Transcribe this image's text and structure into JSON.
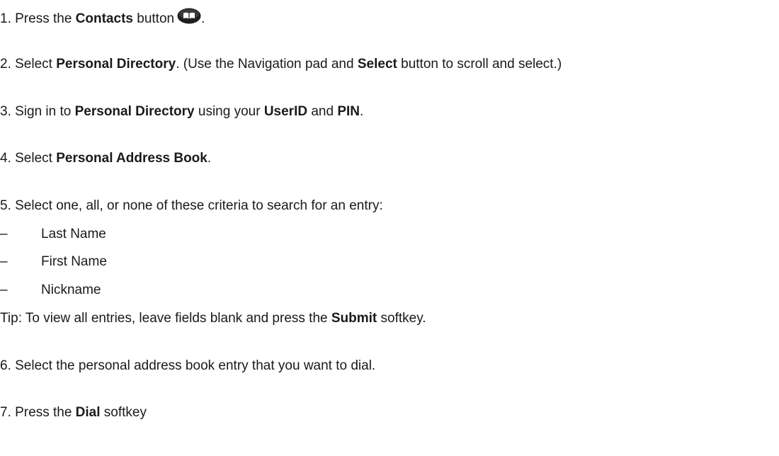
{
  "steps": {
    "s1": {
      "prefix": "1. Press the ",
      "bold1": "Contacts",
      "mid1": " button",
      "suffix": "."
    },
    "s2": {
      "prefix": "2. Select ",
      "bold1": "Personal Directory",
      "mid1": ". (Use the Navigation pad and ",
      "bold2": "Select",
      "suffix": " button to scroll and select.)"
    },
    "s3": {
      "prefix": "3. Sign in to ",
      "bold1": "Personal Directory",
      "mid1": " using your ",
      "bold2": "UserID",
      "mid2": " and ",
      "bold3": "PIN",
      "suffix": "."
    },
    "s4": {
      "prefix": "4. Select ",
      "bold1": "Personal Address Book",
      "suffix": "."
    },
    "s5": {
      "text": "5. Select one, all, or none of these criteria to search for an entry:"
    },
    "criteria": [
      {
        "dash": "–",
        "label": "Last Name"
      },
      {
        "dash": "–",
        "label": "First Name"
      },
      {
        "dash": "–",
        "label": "Nickname"
      }
    ],
    "tip": {
      "prefix": "Tip: To view all entries, leave fields blank and press the ",
      "bold1": "Submit",
      "suffix": " softkey."
    },
    "s6": {
      "text": "6. Select the personal address book entry that you want to dial."
    },
    "s7": {
      "prefix": "7. Press the ",
      "bold1": "Dial",
      "suffix": " softkey"
    }
  },
  "icons": {
    "contacts": "contacts-book-icon"
  }
}
